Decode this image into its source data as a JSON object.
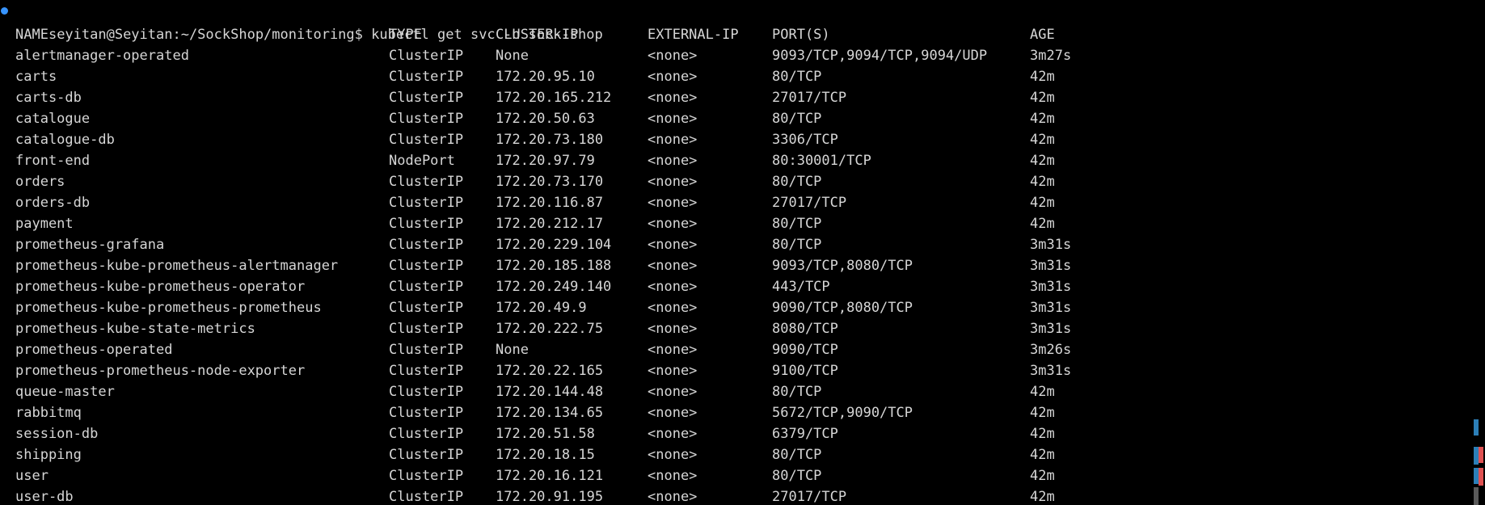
{
  "terminal": {
    "prompt": "seyitan@Seyitan:~/SockShop/monitoring$",
    "command": "kubectl get svc -n sock-shop",
    "headers": [
      "NAME",
      "TYPE",
      "CLUSTER-IP",
      "EXTERNAL-IP",
      "PORT(S)",
      "AGE"
    ],
    "rows": [
      [
        "alertmanager-operated",
        "ClusterIP",
        "None",
        "<none>",
        "9093/TCP,9094/TCP,9094/UDP",
        "3m27s"
      ],
      [
        "carts",
        "ClusterIP",
        "172.20.95.10",
        "<none>",
        "80/TCP",
        "42m"
      ],
      [
        "carts-db",
        "ClusterIP",
        "172.20.165.212",
        "<none>",
        "27017/TCP",
        "42m"
      ],
      [
        "catalogue",
        "ClusterIP",
        "172.20.50.63",
        "<none>",
        "80/TCP",
        "42m"
      ],
      [
        "catalogue-db",
        "ClusterIP",
        "172.20.73.180",
        "<none>",
        "3306/TCP",
        "42m"
      ],
      [
        "front-end",
        "NodePort",
        "172.20.97.79",
        "<none>",
        "80:30001/TCP",
        "42m"
      ],
      [
        "orders",
        "ClusterIP",
        "172.20.73.170",
        "<none>",
        "80/TCP",
        "42m"
      ],
      [
        "orders-db",
        "ClusterIP",
        "172.20.116.87",
        "<none>",
        "27017/TCP",
        "42m"
      ],
      [
        "payment",
        "ClusterIP",
        "172.20.212.17",
        "<none>",
        "80/TCP",
        "42m"
      ],
      [
        "prometheus-grafana",
        "ClusterIP",
        "172.20.229.104",
        "<none>",
        "80/TCP",
        "3m31s"
      ],
      [
        "prometheus-kube-prometheus-alertmanager",
        "ClusterIP",
        "172.20.185.188",
        "<none>",
        "9093/TCP,8080/TCP",
        "3m31s"
      ],
      [
        "prometheus-kube-prometheus-operator",
        "ClusterIP",
        "172.20.249.140",
        "<none>",
        "443/TCP",
        "3m31s"
      ],
      [
        "prometheus-kube-prometheus-prometheus",
        "ClusterIP",
        "172.20.49.9",
        "<none>",
        "9090/TCP,8080/TCP",
        "3m31s"
      ],
      [
        "prometheus-kube-state-metrics",
        "ClusterIP",
        "172.20.222.75",
        "<none>",
        "8080/TCP",
        "3m31s"
      ],
      [
        "prometheus-operated",
        "ClusterIP",
        "None",
        "<none>",
        "9090/TCP",
        "3m26s"
      ],
      [
        "prometheus-prometheus-node-exporter",
        "ClusterIP",
        "172.20.22.165",
        "<none>",
        "9100/TCP",
        "3m31s"
      ],
      [
        "queue-master",
        "ClusterIP",
        "172.20.144.48",
        "<none>",
        "80/TCP",
        "42m"
      ],
      [
        "rabbitmq",
        "ClusterIP",
        "172.20.134.65",
        "<none>",
        "5672/TCP,9090/TCP",
        "42m"
      ],
      [
        "session-db",
        "ClusterIP",
        "172.20.51.58",
        "<none>",
        "6379/TCP",
        "42m"
      ],
      [
        "shipping",
        "ClusterIP",
        "172.20.18.15",
        "<none>",
        "80/TCP",
        "42m"
      ],
      [
        "user",
        "ClusterIP",
        "172.20.16.121",
        "<none>",
        "80/TCP",
        "42m"
      ],
      [
        "user-db",
        "ClusterIP",
        "172.20.91.195",
        "<none>",
        "27017/TCP",
        "42m"
      ]
    ]
  },
  "colors": {
    "background": "#000000",
    "text": "#d6d6d6",
    "prompt_dot": "#3794ff",
    "ruler_blue": "#2c7fb8",
    "ruler_red": "#e05252",
    "ruler_gray": "#5a5a5a"
  }
}
